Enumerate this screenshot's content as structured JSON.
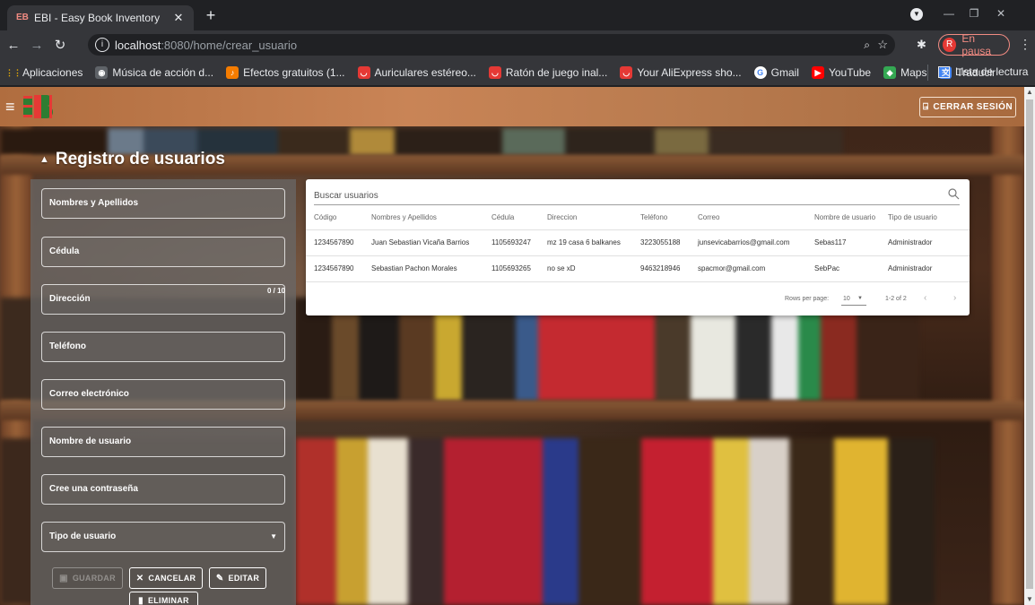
{
  "browser": {
    "tab_title": "EBI - Easy Book Inventory",
    "favicon_text": "EB",
    "url_host": "localhost",
    "url_rest": ":8080/home/crear_usuario",
    "pause_label": "En pausa",
    "profile_initial": "R"
  },
  "bookmarks": [
    {
      "label": "Aplicaciones",
      "icon": "apps-grid-icon",
      "color": "#f4b400"
    },
    {
      "label": "Música de acción d...",
      "icon": "globe-icon",
      "color": "#5f6368"
    },
    {
      "label": "Efectos gratuitos (1...",
      "icon": "music-icon",
      "color": "#f57c00"
    },
    {
      "label": "Auriculares estéreo...",
      "icon": "aliexpress-icon",
      "color": "#e53935"
    },
    {
      "label": "Ratón de juego inal...",
      "icon": "aliexpress-icon",
      "color": "#e53935"
    },
    {
      "label": "Your AliExpress sho...",
      "icon": "aliexpress-icon",
      "color": "#e53935"
    },
    {
      "label": "Gmail",
      "icon": "google-icon",
      "color": "#ffffff"
    },
    {
      "label": "YouTube",
      "icon": "youtube-icon",
      "color": "#ff0000"
    },
    {
      "label": "Maps",
      "icon": "maps-icon",
      "color": "#34a853"
    },
    {
      "label": "Traducir",
      "icon": "translate-icon",
      "color": "#4285f4"
    }
  ],
  "reading_list_label": "Lista de lectura",
  "app": {
    "logout_label": "CERRAR SESIÓN",
    "page_title": "Registro de usuarios"
  },
  "form": {
    "fields": [
      {
        "label": "Nombres y Apellidos"
      },
      {
        "label": "Cédula"
      },
      {
        "label": "Dirección"
      },
      {
        "label": "Teléfono"
      },
      {
        "label": "Correo electrónico"
      },
      {
        "label": "Nombre de usuario"
      },
      {
        "label": "Cree una contraseña"
      },
      {
        "label": "Tipo de usuario"
      }
    ],
    "cedula_counter": "0 / 10",
    "buttons": {
      "save": "GUARDAR",
      "cancel": "CANCELAR",
      "edit": "EDITAR",
      "delete": "ELIMINAR"
    }
  },
  "table": {
    "search_placeholder": "Buscar usuarios",
    "headers": [
      "Código",
      "Nombres y Apellidos",
      "Cédula",
      "Direccion",
      "Teléfono",
      "Correo",
      "Nombre de usuario",
      "Tipo de usuario"
    ],
    "rows": [
      [
        "1234567890",
        "Juan Sebastian Vicaña Barrios",
        "1105693247",
        "mz 19 casa 6 balkanes",
        "3223055188",
        "junsevicabarrios@gmail.com",
        "Sebas117",
        "Administrador"
      ],
      [
        "1234567890",
        "Sebastian Pachon Morales",
        "1105693265",
        "no se xD",
        "9463218946",
        "spacmor@gmail.com",
        "SebPac",
        "Administrador"
      ]
    ],
    "rows_per_page_label": "Rows per page:",
    "rows_per_page": "10",
    "range": "1-2 of 2"
  }
}
